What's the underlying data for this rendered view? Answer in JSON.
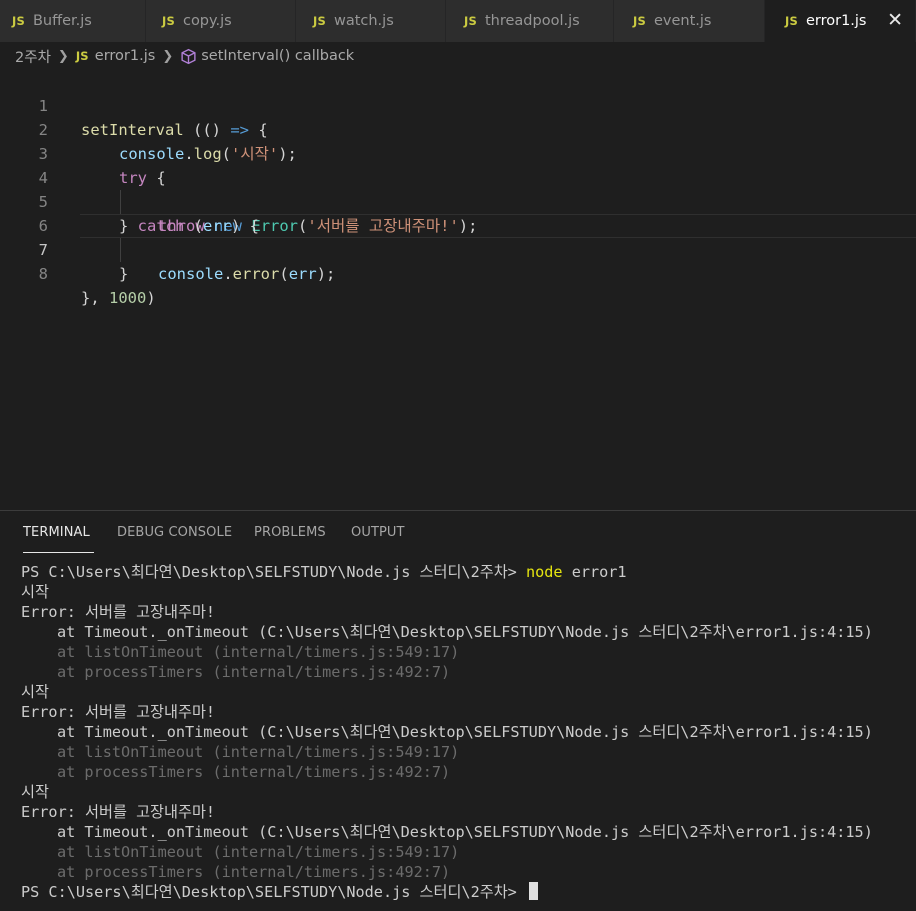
{
  "tabs": [
    {
      "icon": "JS",
      "label": "Buffer.js",
      "active": false
    },
    {
      "icon": "JS",
      "label": "copy.js",
      "active": false
    },
    {
      "icon": "JS",
      "label": "watch.js",
      "active": false
    },
    {
      "icon": "JS",
      "label": "threadpool.js",
      "active": false
    },
    {
      "icon": "JS",
      "label": "event.js",
      "active": false
    },
    {
      "icon": "JS",
      "label": "error1.js",
      "active": true
    }
  ],
  "close_symbol": "✕",
  "breadcrumb": {
    "folder": "2주차",
    "file_icon": "JS",
    "file": "error1.js",
    "symbol": "setInterval() callback"
  },
  "editor": {
    "current_line": 7,
    "line_numbers": [
      "1",
      "2",
      "3",
      "4",
      "5",
      "6",
      "7",
      "8"
    ],
    "code": {
      "l1": {
        "fn": "setInterval",
        "a": " ((",
        "b": ") ",
        "arrow": "=>",
        "c": " {"
      },
      "l2": {
        "obj": "console",
        "dot": ".",
        "fn": "log",
        "open": "(",
        "str": "'시작'",
        "close": ");"
      },
      "l3": {
        "kw": "try",
        "rest": " {"
      },
      "l4": {
        "kw1": "throw",
        "sp1": " ",
        "kw2": "new",
        "sp2": " ",
        "cls": "Error",
        "open": "(",
        "str": "'서버를 고장내주마!'",
        "close": ");"
      },
      "l5": {
        "a": "} ",
        "kw": "catch",
        "b": " (",
        "var": "err",
        "c": ") {"
      },
      "l6": {
        "obj": "console",
        "dot": ".",
        "fn": "error",
        "open": "(",
        "var": "err",
        "close": ");"
      },
      "l7": {
        "text": "}"
      },
      "l8": {
        "a": "}, ",
        "num": "1000",
        "b": ")"
      }
    }
  },
  "panel": {
    "tabs": [
      "TERMINAL",
      "DEBUG CONSOLE",
      "PROBLEMS",
      "OUTPUT"
    ],
    "active_tab": "TERMINAL"
  },
  "terminal": {
    "prompt": "PS C:\\Users\\최다연\\Desktop\\SELFSTUDY\\Node.js 스터디\\2주차> ",
    "command": "node",
    "command_arg": " error1",
    "log_output": "시작",
    "error_line": "Error: 서버를 고장내주마!",
    "stack": [
      "at Timeout._onTimeout (C:\\Users\\최다연\\Desktop\\SELFSTUDY\\Node.js 스터디\\2주차\\error1.js:4:15)",
      "at listOnTimeout (internal/timers.js:549:17)",
      "at processTimers (internal/timers.js:492:7)"
    ],
    "final_prompt": "PS C:\\Users\\최다연\\Desktop\\SELFSTUDY\\Node.js 스터디\\2주차> "
  }
}
